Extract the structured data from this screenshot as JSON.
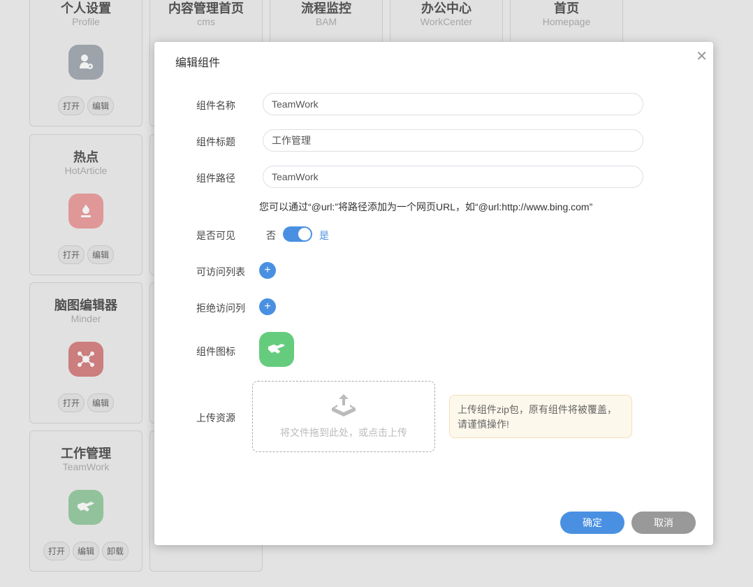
{
  "cards": [
    {
      "title": "个人设置",
      "subtitle": "Profile",
      "icon": "user-settings-icon",
      "color": "#a6aeb5",
      "buttons": [
        "打开",
        "编辑"
      ]
    },
    {
      "title": "内容管理首页",
      "subtitle": "cms"
    },
    {
      "title": "流程监控",
      "subtitle": "BAM"
    },
    {
      "title": "办公中心",
      "subtitle": "WorkCenter"
    },
    {
      "title": "首页",
      "subtitle": "Homepage"
    },
    {
      "title": "热点",
      "subtitle": "HotArticle",
      "icon": "fire-icon",
      "color": "#eda1a1",
      "buttons": [
        "打开",
        "编辑"
      ]
    },
    {
      "title": "脑图编辑器",
      "subtitle": "Minder",
      "icon": "mindmap-icon",
      "color": "#d98585",
      "buttons": [
        "打开",
        "编辑"
      ]
    },
    {
      "title": "工作管理",
      "subtitle": "TeamWork",
      "icon": "handshake-icon",
      "color": "#9ccfa5",
      "buttons": [
        "打开",
        "编辑",
        "卸载"
      ]
    }
  ],
  "modal": {
    "title": "编辑组件",
    "close": "✕",
    "name_label": "组件名称",
    "name_value": "TeamWork",
    "title_label": "组件标题",
    "title_value": "工作管理",
    "path_label": "组件路径",
    "path_value": "TeamWork",
    "path_hint": "您可以通过“@url:”将路径添加为一个网页URL，如“@url:http://www.bing.com”",
    "visible_label": "是否可见",
    "visible_off": "否",
    "visible_on": "是",
    "visible": true,
    "allow_label": "可访问列表",
    "deny_label": "拒绝访问列",
    "plus": "+",
    "icon_label": "组件图标",
    "icon_color": "#66cc7d",
    "upload_label": "上传资源",
    "upload_text": "将文件拖到此处，或点击上传",
    "warning": "上传组件zip包，原有组件将被覆盖，请谨慎操作!",
    "ok": "确定",
    "cancel": "取消",
    "ok_color": "#4a90e2",
    "cancel_color": "#999999"
  }
}
